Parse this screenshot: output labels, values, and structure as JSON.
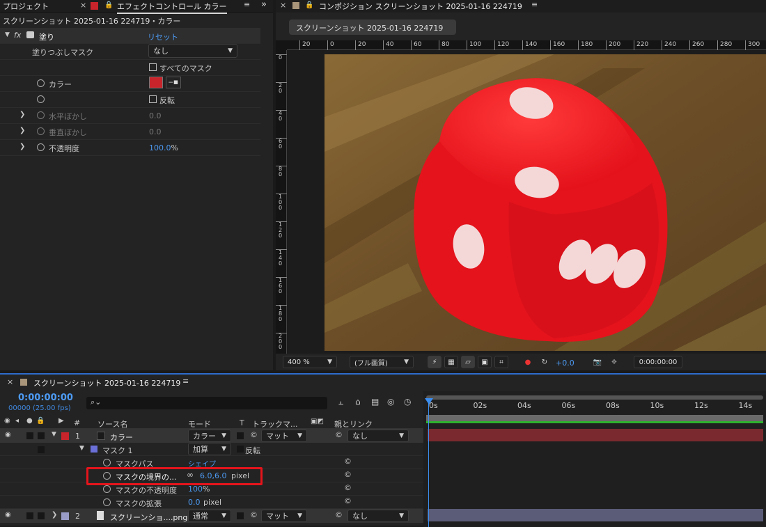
{
  "left_panel": {
    "tab_project": "プロジェクト",
    "tab_effects": "エフェクトコントロール カラー",
    "close": "×",
    "lock": "🔒",
    "menu": "≡",
    "expand": "»",
    "subtitle": "スクリーンショット 2025-01-16 224719・カラー",
    "fx_label": "fx",
    "effect_name": "塗り",
    "reset": "リセット",
    "fill_mask_label": "塗りつぶしマスク",
    "fill_mask_value": "なし",
    "all_masks": "すべてのマスク",
    "color_label": "カラー",
    "color_value": "#c8242b",
    "invert": "反転",
    "h_feather_label": "水平ぼかし",
    "h_feather_value": "0.0",
    "v_feather_label": "垂直ぼかし",
    "v_feather_value": "0.0",
    "opacity_label": "不透明度",
    "opacity_value": "100.0",
    "opacity_unit": "%"
  },
  "comp_panel": {
    "close": "×",
    "lock": "🔒",
    "title": "コンポジション スクリーンショット 2025-01-16 224719",
    "menu": "≡",
    "tab": "スクリーンショット 2025-01-16 224719",
    "ruler_h": [
      "20",
      "0",
      "20",
      "40",
      "60",
      "80",
      "100",
      "120",
      "140",
      "160",
      "180",
      "200",
      "220",
      "240",
      "260",
      "280",
      "300"
    ],
    "ruler_v": [
      "0",
      "2\n0",
      "4\n0",
      "6\n0",
      "8\n0",
      "1\n0\n0",
      "1\n2\n0",
      "1\n4\n0",
      "1\n6\n0",
      "1\n8\n0",
      "2\n0\n0"
    ],
    "zoom": "400 %",
    "quality": "(フル画質)",
    "exposure": "+0.0",
    "timecode": "0:00:00:00",
    "die_color": "#e8141f"
  },
  "timeline": {
    "close": "×",
    "title": "スクリーンショット 2025-01-16 224719",
    "menu": "≡",
    "current_time": "0:00:00:00",
    "frames": "00000 (25.00 fps)",
    "search_icon": "🔍",
    "col_source": "ソース名",
    "col_mode": "モード",
    "col_t": "T",
    "col_track": "トラックマ...",
    "col_parent": "親とリンク",
    "hash": "#",
    "ticks": [
      "0s",
      "02s",
      "04s",
      "06s",
      "08s",
      "10s",
      "12s",
      "14s"
    ],
    "layer1": {
      "num": "1",
      "name": "カラー",
      "mode": "カラー",
      "matte": "マット",
      "parent": "なし",
      "color": "#c8242b"
    },
    "mask1": {
      "name": "マスク 1",
      "mode": "加算",
      "invert": "反転",
      "swatch": "#6b70d8"
    },
    "mask_path_label": "マスクパス",
    "mask_path_value": "シェイプ",
    "mask_feather_label": "マスクの境界の...",
    "mask_feather_value": "6.0,6.0",
    "mask_feather_unit": "pixel",
    "mask_opacity_label": "マスクの不透明度",
    "mask_opacity_value": "100",
    "mask_opacity_unit": "%",
    "mask_expand_label": "マスクの拡張",
    "mask_expand_value": "0.0",
    "mask_expand_unit": "pixel",
    "layer2": {
      "num": "2",
      "name": "スクリーンショ....png",
      "mode": "通常",
      "matte": "マット",
      "parent": "なし",
      "color": "#9a9cc8"
    },
    "highlight_color": "#e5141b"
  }
}
